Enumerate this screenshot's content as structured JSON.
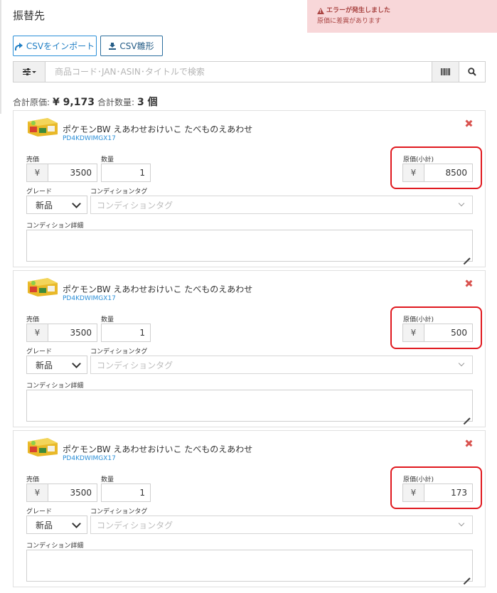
{
  "page": {
    "title": "振替先"
  },
  "alert": {
    "title": "エラーが発生しました",
    "message": "原価に差異があります"
  },
  "toolbar": {
    "import_label": "CSVをインポート",
    "template_label": "CSV雛形"
  },
  "search": {
    "placeholder": "商品コード･JAN･ASIN･タイトルで検索"
  },
  "totals": {
    "cost_label": "合計原価:",
    "cost_value": "¥ 9,173",
    "qty_label": "合計数量:",
    "qty_value": "3 個"
  },
  "labels": {
    "price": "売価",
    "quantity": "数量",
    "cost_subtotal": "原価(小計)",
    "grade": "グレード",
    "condition_tag": "コンディションタグ",
    "condition_detail": "コンディション詳細",
    "yen": "¥"
  },
  "items": [
    {
      "title": "ポケモンBW えあわせおけいこ たべものえあわせ",
      "code": "PD4KDWIMGX17",
      "price": "3500",
      "quantity": "1",
      "cost": "8500",
      "grade": "新品",
      "tag_placeholder": "コンディションタグ",
      "detail": ""
    },
    {
      "title": "ポケモンBW えあわせおけいこ たべものえあわせ",
      "code": "PD4KDWIMGX17",
      "price": "3500",
      "quantity": "1",
      "cost": "500",
      "grade": "新品",
      "tag_placeholder": "コンディションタグ",
      "detail": ""
    },
    {
      "title": "ポケモンBW えあわせおけいこ たべものえあわせ",
      "code": "PD4KDWIMGX17",
      "price": "3500",
      "quantity": "1",
      "cost": "173",
      "grade": "新品",
      "tag_placeholder": "コンディションタグ",
      "detail": ""
    }
  ]
}
